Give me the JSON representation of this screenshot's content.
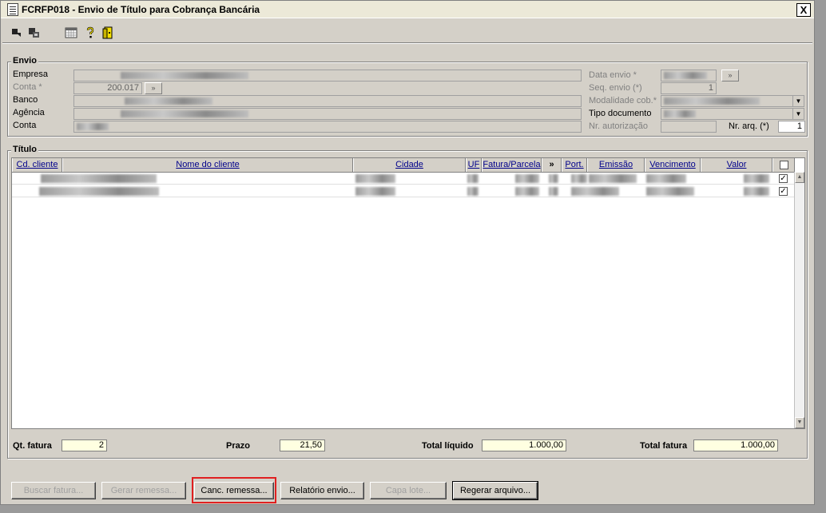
{
  "window": {
    "title": "FCRFP018 - Envio de Título para Cobrança Bancária",
    "close_label": "X"
  },
  "toolbar": {
    "icons": [
      "forward-icon",
      "copy-icon",
      "calendar-icon",
      "help-icon",
      "exit-icon"
    ]
  },
  "envio": {
    "group_label": "Envio",
    "empresa_label": "Empresa",
    "conta_star_label": "Conta *",
    "conta_star_value": "200.017",
    "banco_label": "Banco",
    "agencia_label": "Agência",
    "conta_label": "Conta",
    "data_envio_label": "Data envio *",
    "seq_envio_label": "Seq. envio (*)",
    "seq_envio_value": "1",
    "modalidade_label": "Modalidade cob.*",
    "tipo_documento_label": "Tipo documento",
    "nr_autorizacao_label": "Nr. autorização",
    "nr_arq_label": "Nr. arq. (*)",
    "nr_arq_value": "1",
    "lookup_label": "»"
  },
  "titulo": {
    "group_label": "Título",
    "columns": [
      "Cd. cliente",
      "Nome do cliente",
      "Cidade",
      "UF",
      "Fatura/Parcela",
      "»",
      "Port.",
      "Emissão",
      "Vencimento",
      "Valor"
    ],
    "rows": [
      {
        "checked": true
      },
      {
        "checked": true
      }
    ]
  },
  "totals": {
    "qt_fatura_label": "Qt. fatura",
    "qt_fatura_value": "2",
    "prazo_label": "Prazo",
    "prazo_value": "21,50",
    "total_liquido_label": "Total líquido",
    "total_liquido_value": "1.000,00",
    "total_fatura_label": "Total fatura",
    "total_fatura_value": "1.000,00"
  },
  "buttons": {
    "buscar": "Buscar fatura...",
    "gerar": "Gerar remessa...",
    "canc": "Canc. remessa...",
    "relatorio": "Relatório envio...",
    "capa": "Capa lote...",
    "regerar": "Regerar arquivo..."
  },
  "colors": {
    "highlight": "#e02020",
    "column_header_text": "#00008b",
    "input_yellow": "#ffffe1"
  }
}
